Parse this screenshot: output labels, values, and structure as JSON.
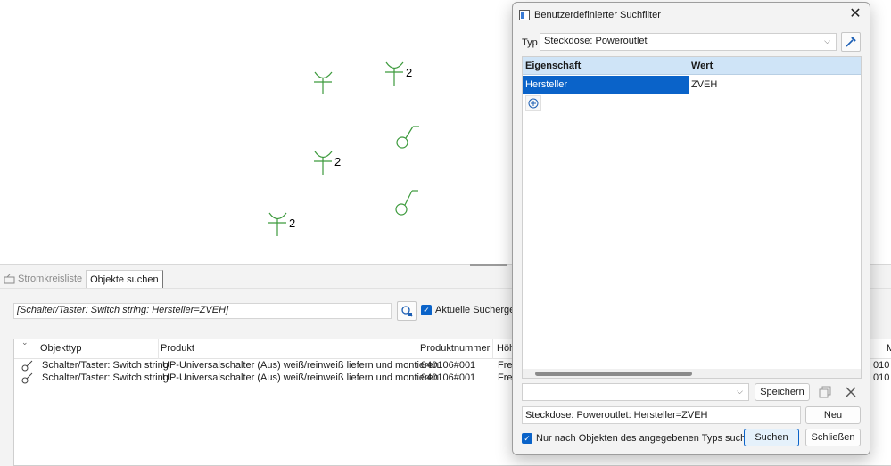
{
  "canvas": {
    "symbol_labels": [
      "2",
      "2",
      "2"
    ],
    "symbol_color": "#3c9a3c"
  },
  "panel": {
    "tabs": [
      {
        "label": "Stromkreisliste",
        "icon": "circuit-icon",
        "active": false
      },
      {
        "label": "Objekte suchen",
        "active": true
      }
    ],
    "filter_text": "[Schalter/Taster: Switch string: Hersteller=ZVEH]",
    "search_button_icon": "search-filter-icon",
    "current_results_checkbox": {
      "label": "Aktuelle Suchergeb",
      "checked": true
    },
    "grid": {
      "columns": [
        "Objekttyp",
        "Produkt",
        "Produktnummer",
        "Höh",
        "M"
      ],
      "rows": [
        {
          "objekttyp": "Schalter/Taster: Switch string",
          "produkt": "UP-Universalschalter (Aus) weiß/reinweiß liefern und montieren",
          "produktnummer": "040106#001",
          "hoehe": "Frei",
          "extra": "010"
        },
        {
          "objekttyp": "Schalter/Taster: Switch string",
          "produkt": "UP-Universalschalter (Aus) weiß/reinweiß liefern und montieren",
          "produktnummer": "040106#001",
          "hoehe": "Frei",
          "extra": "010"
        }
      ]
    }
  },
  "dialog": {
    "title": "Benutzerdefinierter Suchfilter",
    "typ_label": "Typ",
    "typ_value": "Steckdose: Poweroutlet",
    "property_grid": {
      "col_property": "Eigenschaft",
      "col_value": "Wert",
      "rows": [
        {
          "property": "Hersteller",
          "value": "ZVEH"
        }
      ]
    },
    "saved_filter_value": "",
    "save_button": "Speichern",
    "filter_expression": "Steckdose: Poweroutlet: Hersteller=ZVEH",
    "new_button": "Neu",
    "only_type_checkbox": {
      "label": "Nur nach Objekten des angegebenen Typs suchen",
      "checked": true
    },
    "search_button": "Suchen",
    "close_button": "Schließen",
    "accent_color": "#0a63c9",
    "header_color": "#cfe4f7"
  }
}
